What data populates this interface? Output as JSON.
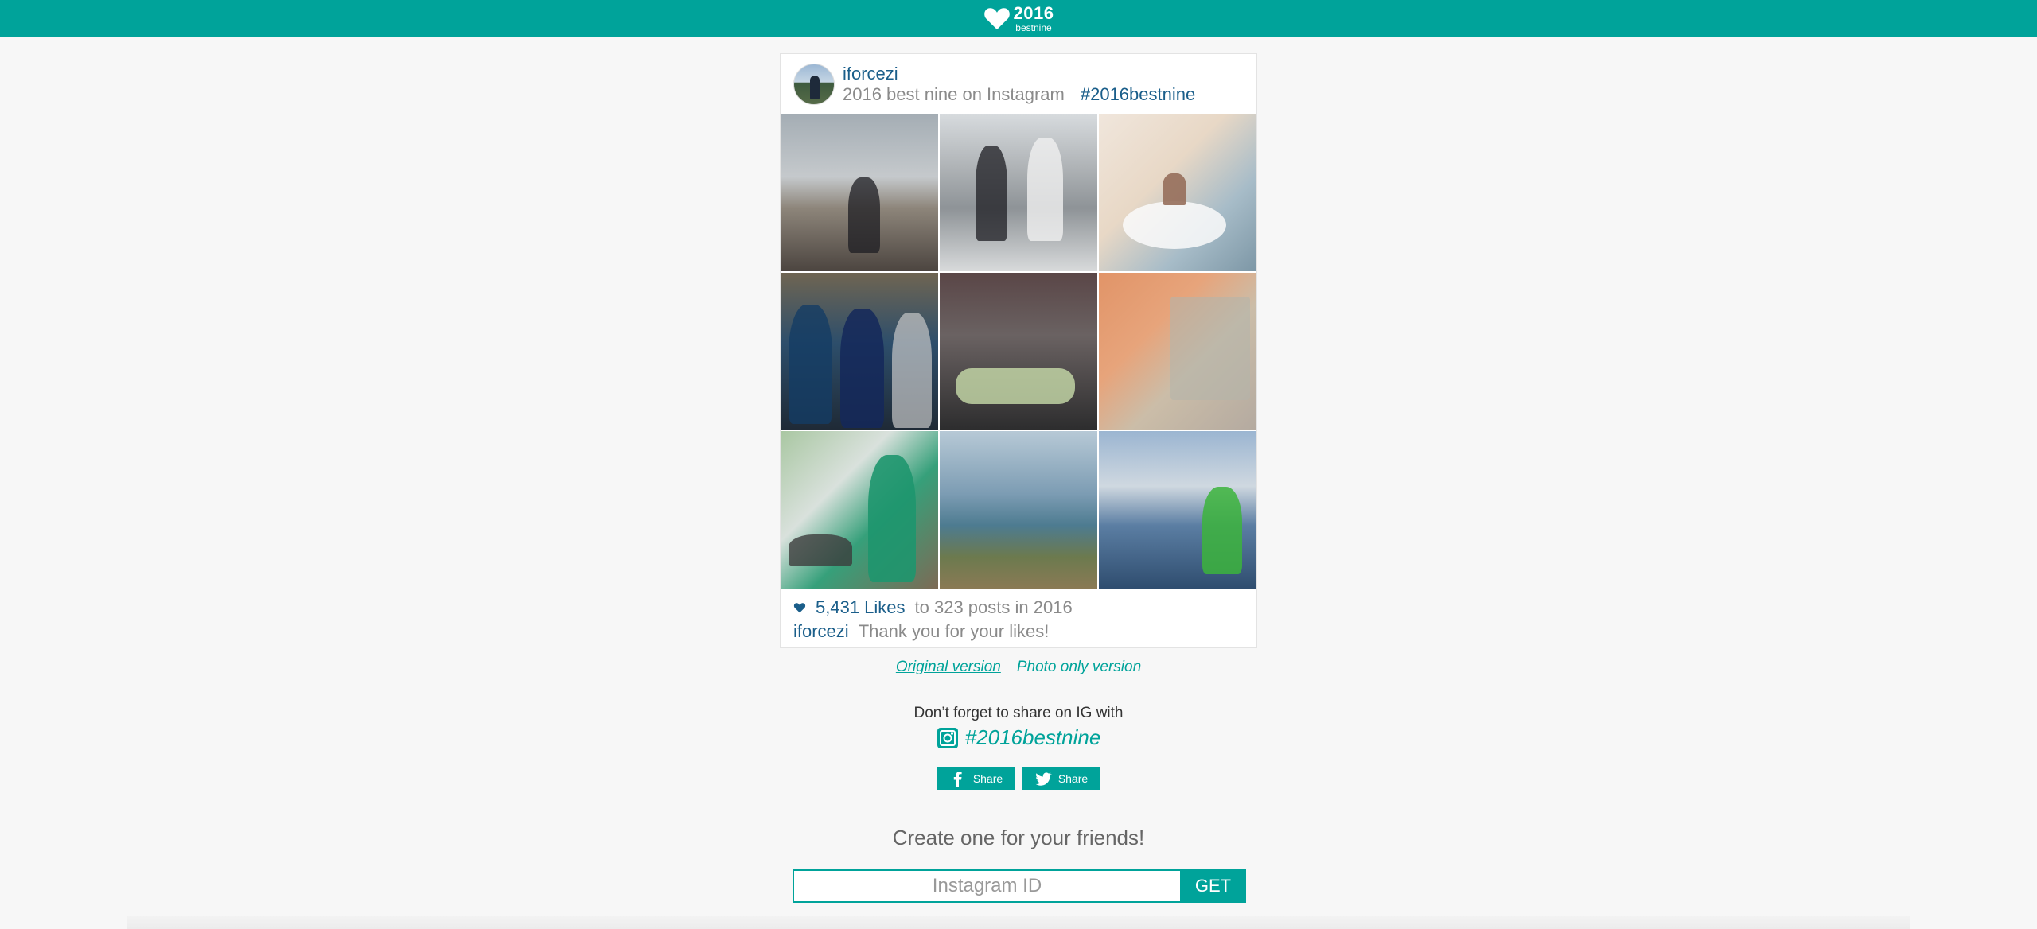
{
  "header": {
    "logo_year": "2016",
    "logo_sub": "bestnine",
    "bg_color": "#00a39a",
    "icon": "heart-icon"
  },
  "card": {
    "username": "iforcezi",
    "description": "2016 best nine on Instagram",
    "hashtag": "#2016bestnine",
    "photos": [
      {
        "name": "photo-1"
      },
      {
        "name": "photo-2"
      },
      {
        "name": "photo-3"
      },
      {
        "name": "photo-4"
      },
      {
        "name": "photo-5"
      },
      {
        "name": "photo-6"
      },
      {
        "name": "photo-7"
      },
      {
        "name": "photo-8"
      },
      {
        "name": "photo-9"
      }
    ],
    "likes_count": "5,431 Likes",
    "likes_rest": "to 323 posts in 2016",
    "thanks_user": "iforcezi",
    "thanks_message": "Thank you for your likes!"
  },
  "versions": {
    "original": "Original version",
    "photo_only": "Photo only version"
  },
  "share": {
    "text": "Don’t forget to share on IG with",
    "hashtag": "#2016bestnine",
    "facebook_label": "Share",
    "twitter_label": "Share"
  },
  "create": {
    "heading": "Create one for your friends!",
    "input_placeholder": "Instagram ID",
    "button_label": "GET"
  },
  "colors": {
    "accent": "#00a39a",
    "link_blue": "#1a5e8a"
  }
}
